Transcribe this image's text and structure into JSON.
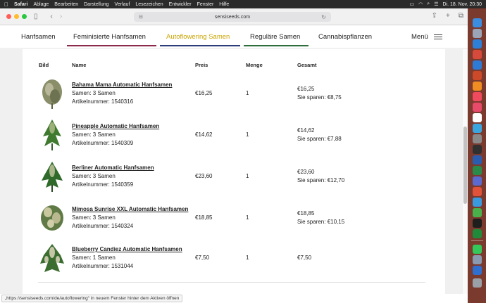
{
  "menubar": {
    "app": "Safari",
    "items": [
      "Ablage",
      "Bearbeiten",
      "Darstellung",
      "Verlauf",
      "Lesezeichen",
      "Entwickler",
      "Fenster",
      "Hilfe"
    ],
    "clock": "Di. 18. Nov.  20:30"
  },
  "browser": {
    "url": "sensiseeds.com"
  },
  "nav": {
    "items": [
      "Hanfsamen",
      "Feminisierte Hanfsamen",
      "Autoflowering Samen",
      "Reguläre Samen",
      "Cannabispflanzen"
    ],
    "menu_label": "Menü",
    "colors": {
      "feminized": "#8c2a4a",
      "autoflowering": "#2c3e7a",
      "regular": "#2f6e3a",
      "active_text": "#c9a400"
    }
  },
  "table": {
    "headers": [
      "Bild",
      "Name",
      "Preis",
      "Menge",
      "Gesamt"
    ],
    "rows": [
      {
        "name": "Bahama Mama Automatic Hanfsamen",
        "seeds": "Samen: 3 Samen",
        "article": "Artikelnummer: 1540316",
        "price": "€16,25",
        "qty": "1",
        "total": "€16,25",
        "savings": "Sie sparen: €8,75"
      },
      {
        "name": "Pineapple Automatic Hanfsamen",
        "seeds": "Samen: 3 Samen",
        "article": "Artikelnummer: 1540309",
        "price": "€14,62",
        "qty": "1",
        "total": "€14,62",
        "savings": "Sie sparen: €7,88"
      },
      {
        "name": "Berliner Automatic Hanfsamen",
        "seeds": "Samen: 3 Samen",
        "article": "Artikelnummer: 1540359",
        "price": "€23,60",
        "qty": "1",
        "total": "€23,60",
        "savings": "Sie sparen: €12,70"
      },
      {
        "name": "Mimosa Sunrise XXL Automatic Hanfsamen",
        "seeds": "Samen: 3 Samen",
        "article": "Artikelnummer: 1540324",
        "price": "€18,85",
        "qty": "1",
        "total": "€18,85",
        "savings": "Sie sparen: €10,15"
      },
      {
        "name": "Blueberry Candiez Automatic Hanfsamen",
        "seeds": "Samen: 1 Samen",
        "article": "Artikelnummer: 1531044",
        "price": "€7,50",
        "qty": "1",
        "total": "€7,50",
        "savings": ""
      }
    ]
  },
  "status": {
    "text": "„https://sensiseeds.com/de/autoflowering“ in neuem Fenster hinter dem Aktiven öffnen"
  }
}
